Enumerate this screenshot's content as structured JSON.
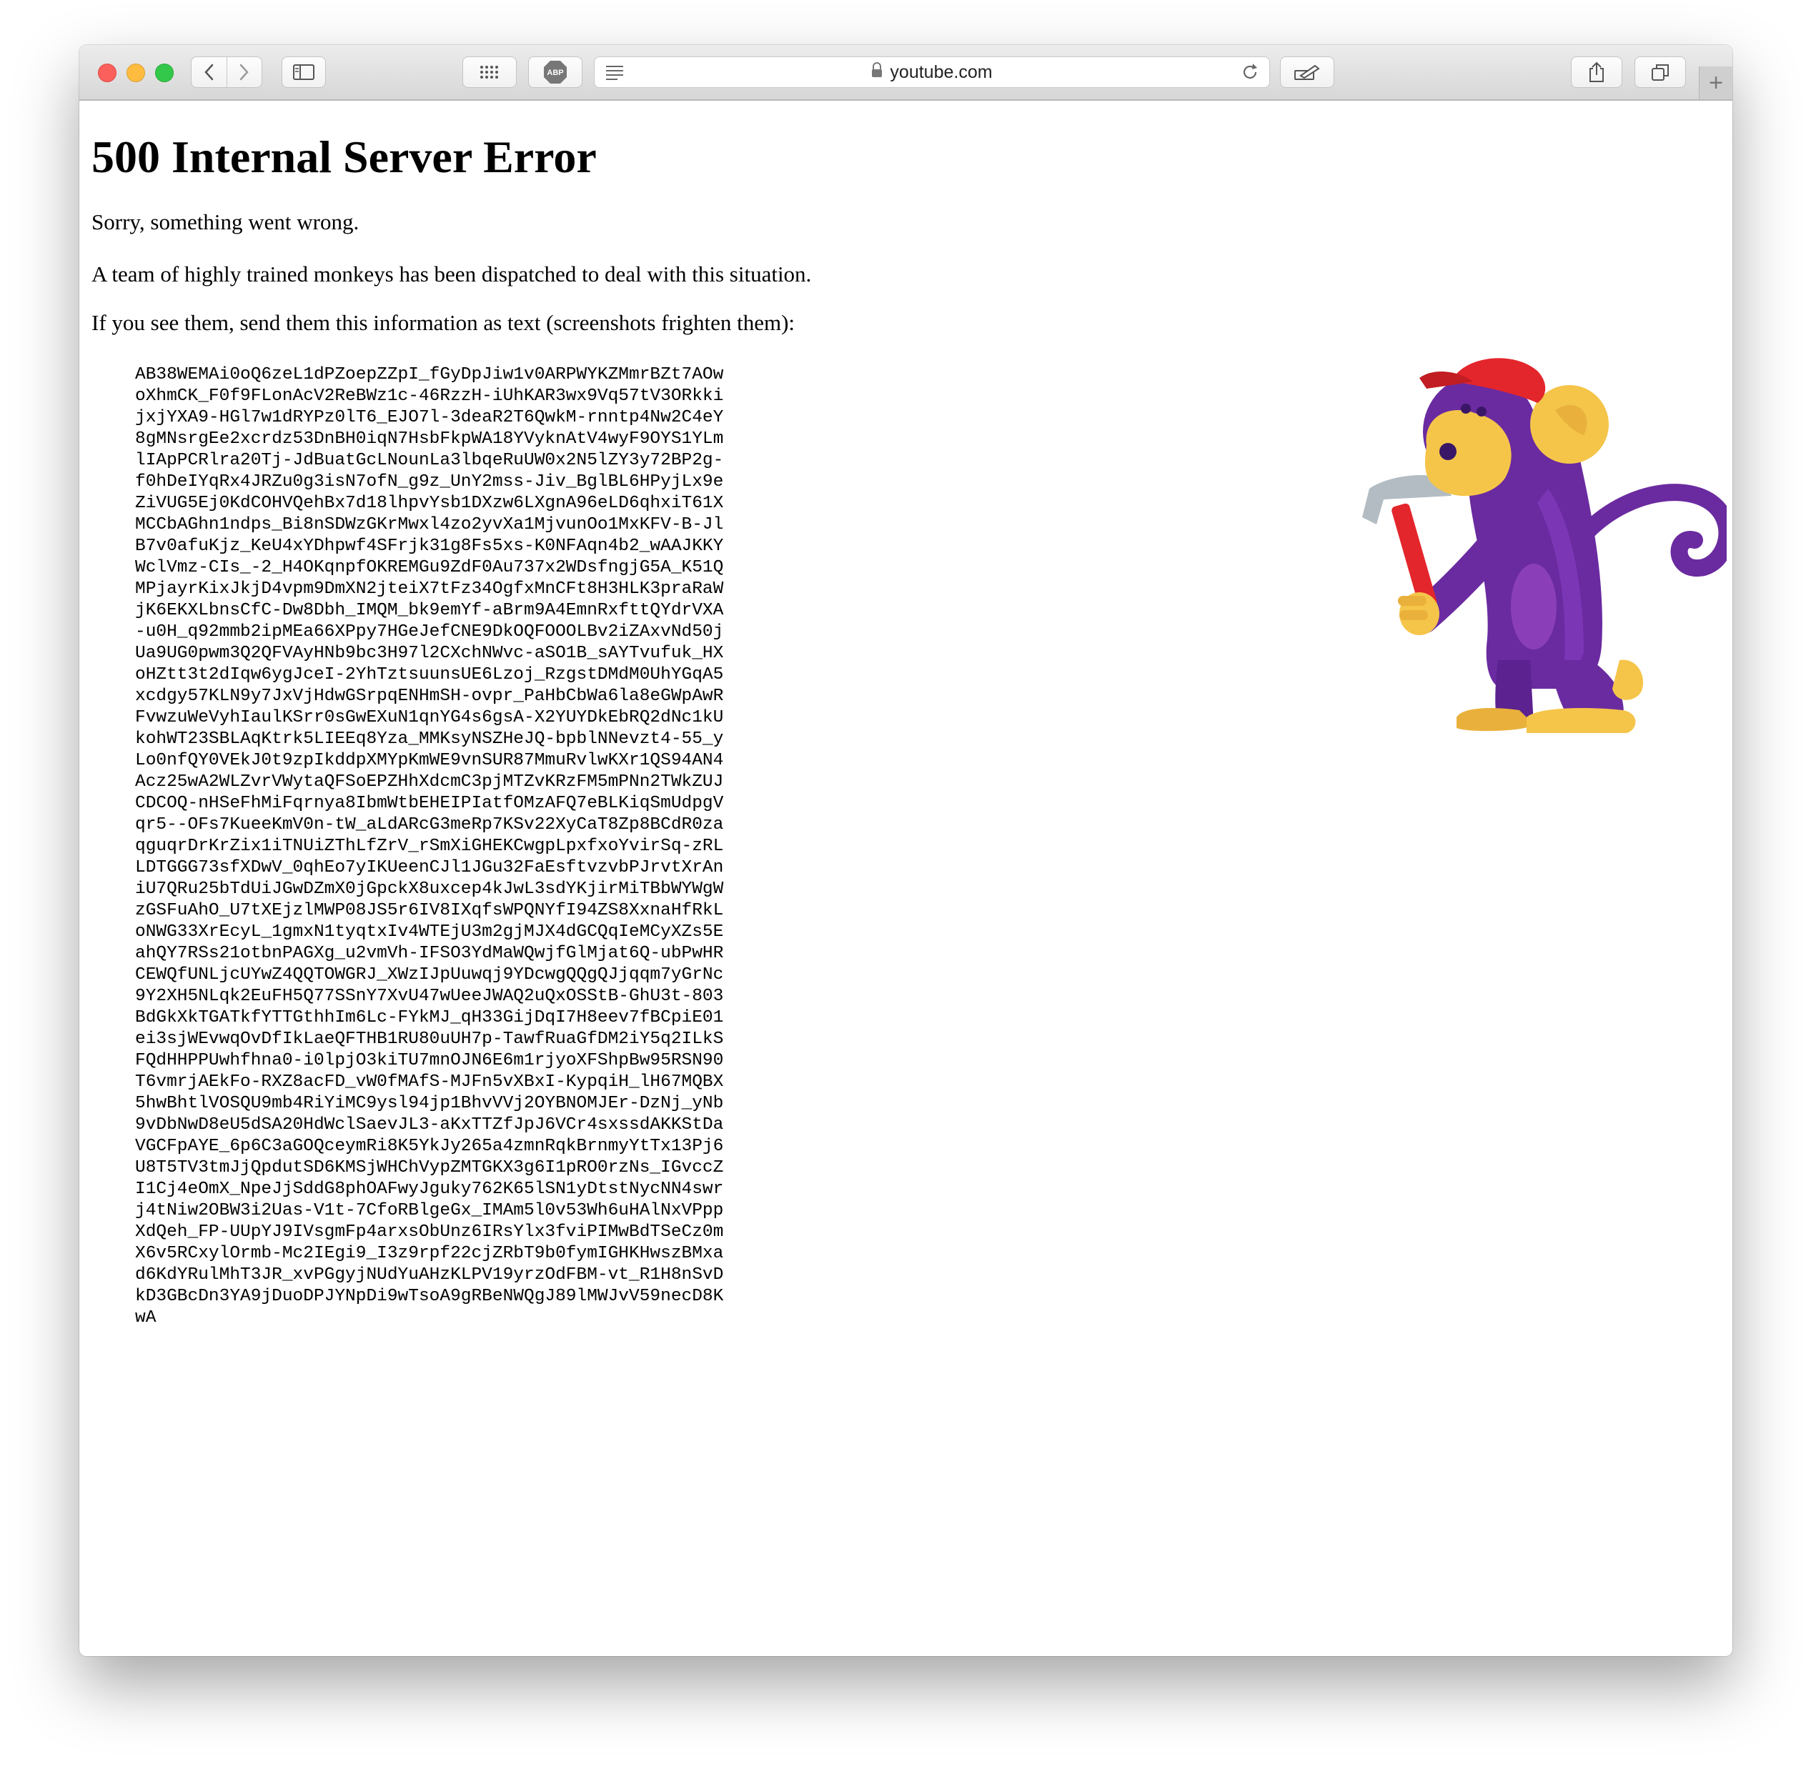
{
  "browser": {
    "url": "youtube.com",
    "new_tab_label": "+",
    "adblock_label": "ABP"
  },
  "page": {
    "title": "500 Internal Server Error",
    "p1": "Sorry, something went wrong.",
    "p2": "A team of highly trained monkeys has been dispatched to deal with this situation.",
    "p3": "If you see them, send them this information as text (screenshots frighten them):",
    "debug_lines": [
      "AB38WEMAi0oQ6zeL1dPZoepZZpI_fGyDpJiw1v0ARPWYKZMmrBZt7AOw",
      "oXhmCK_F0f9FLonAcV2ReBWz1c-46RzzH-iUhKAR3wx9Vq57tV3ORkki",
      "jxjYXA9-HGl7w1dRYPz0lT6_EJO7l-3deaR2T6QwkM-rnntp4Nw2C4eY",
      "8gMNsrgEe2xcrdz53DnBH0iqN7HsbFkpWA18YVyknAtV4wyF9OYS1YLm",
      "lIApPCRlra20Tj-JdBuatGcLNounLa3lbqeRuUW0x2N5lZY3y72BP2g-",
      "f0hDeIYqRx4JRZu0g3isN7ofN_g9z_UnY2mss-Jiv_BglBL6HPyjLx9e",
      "ZiVUG5Ej0KdCOHVQehBx7d18lhpvYsb1DXzw6LXgnA96eLD6qhxiT61X",
      "MCCbAGhn1ndps_Bi8nSDWzGKrMwxl4zo2yvXa1MjvunOo1MxKFV-B-Jl",
      "B7v0afuKjz_KeU4xYDhpwf4SFrjk31g8Fs5xs-K0NFAqn4b2_wAAJKKY",
      "WclVmz-CIs_-2_H4OKqnpfOKREMGu9ZdF0Au737x2WDsfngjG5A_K51Q",
      "MPjayrKixJkjD4vpm9DmXN2jteiX7tFz34OgfxMnCFt8H3HLK3praRaW",
      "jK6EKXLbnsCfC-Dw8Dbh_IMQM_bk9emYf-aBrm9A4EmnRxfttQYdrVXA",
      "-u0H_q92mmb2ipMEa66XPpy7HGeJefCNE9DkOQFOOOLBv2iZAxvNd50j",
      "Ua9UG0pwm3Q2QFVAyHNb9bc3H97l2CXchNWvc-aSO1B_sAYTvufuk_HX",
      "oHZtt3t2dIqw6ygJceI-2YhTztsuunsUE6Lzoj_RzgstDMdM0UhYGqA5",
      "xcdgy57KLN9y7JxVjHdwGSrpqENHmSH-ovpr_PaHbCbWa6la8eGWpAwR",
      "FvwzuWeVyhIaulKSrr0sGwEXuN1qnYG4s6gsA-X2YUYDkEbRQ2dNc1kU",
      "kohWT23SBLAqKtrk5LIEEq8Yza_MMKsyNSZHeJQ-bpblNNevzt4-55_y",
      "Lo0nfQY0VEkJ0t9zpIkddpXMYpKmWE9vnSUR87MmuRvlwKXr1QS94AN4",
      "Acz25wA2WLZvrVWytaQFSoEPZHhXdcmC3pjMTZvKRzFM5mPNn2TWkZUJ",
      "CDCOQ-nHSeFhMiFqrnya8IbmWtbEHEIPIatfOMzAFQ7eBLKiqSmUdpgV",
      "qr5--OFs7KueeKmV0n-tW_aLdARcG3meRp7KSv22XyCaT8Zp8BCdR0za",
      "qguqrDrKrZix1iTNUiZThLfZrV_rSmXiGHEKCwgpLpxfxoYvirSq-zRL",
      "LDTGGG73sfXDwV_0qhEo7yIKUeenCJl1JGu32FaEsftvzvbPJrvtXrAn",
      "iU7QRu25bTdUiJGwDZmX0jGpckX8uxcep4kJwL3sdYKjirMiTBbWYWgW",
      "zGSFuAhO_U7tXEjzlMWP08JS5r6IV8IXqfsWPQNYfI94ZS8XxnaHfRkL",
      "oNWG33XrEcyL_1gmxN1tyqtxIv4WTEjU3m2gjMJX4dGCQqIeMCyXZs5E",
      "ahQY7RSs21otbnPAGXg_u2vmVh-IFSO3YdMaWQwjfGlMjat6Q-ubPwHR",
      "CEWQfUNLjcUYwZ4QQTOWGRJ_XWzIJpUuwqj9YDcwgQQgQJjqqm7yGrNc",
      "9Y2XH5NLqk2EuFH5Q77SSnY7XvU47wUeeJWAQ2uQxOSStB-GhU3t-803",
      "BdGkXkTGATkfYTTGthhIm6Lc-FYkMJ_qH33GijDqI7H8eev7fBCpiE01",
      "ei3sjWEvwqOvDfIkLaeQFTHB1RU80uUH7p-TawfRuaGfDM2iY5q2ILkS",
      "FQdHHPPUwhfhna0-i0lpjO3kiTU7mnOJN6E6m1rjyoXFShpBw95RSN90",
      "T6vmrjAEkFo-RXZ8acFD_vW0fMAfS-MJFn5vXBxI-KypqiH_lH67MQBX",
      "5hwBhtlVOSQU9mb4RiYiMC9ysl94jp1BhvVVj2OYBNOMJEr-DzNj_yNb",
      "9vDbNwD8eU5dSA20HdWclSaevJL3-aKxTTZfJpJ6VCr4sxssdAKKStDa",
      "VGCFpAYE_6p6C3aGOQceymRi8K5YkJy265a4zmnRqkBrnmyYtTx13Pj6",
      "U8T5TV3tmJjQpdutSD6KMSjWHChVypZMTGKX3g6I1pRO0rzNs_IGvccZ",
      "I1Cj4eOmX_NpeJjSddG8phOAFwyJguky762K65lSN1yDtstNycNN4swr",
      "j4tNiw2OBW3i2Uas-V1t-7CfoRBlgeGx_IMAm5l0v53Wh6uHAlNxVPpp",
      "XdQeh_FP-UUpYJ9IVsgmFp4arxsObUnz6IRsYlx3fviPIMwBdTSeCz0m",
      "X6v5RCxylOrmb-Mc2IEgi9_I3z9rpf22cjZRbT9b0fymIGHKHwszBMxa",
      "d6KdYRulMhT3JR_xvPGgyjNUdYuAHzKLPV19yrzOdFBM-vt_R1H8nSvD",
      "kD3GBcDn3YA9jDuoDPJYNpDi9wTsoA9gRBeNWQgJ89lMWJvV59necD8K",
      "wA"
    ]
  },
  "colors": {
    "monkey_body": "#6a2aa0",
    "monkey_face": "#f5c54a",
    "cap": "#e3262c",
    "hammer_handle": "#e3262c",
    "hammer_head": "#b2bcc2"
  }
}
